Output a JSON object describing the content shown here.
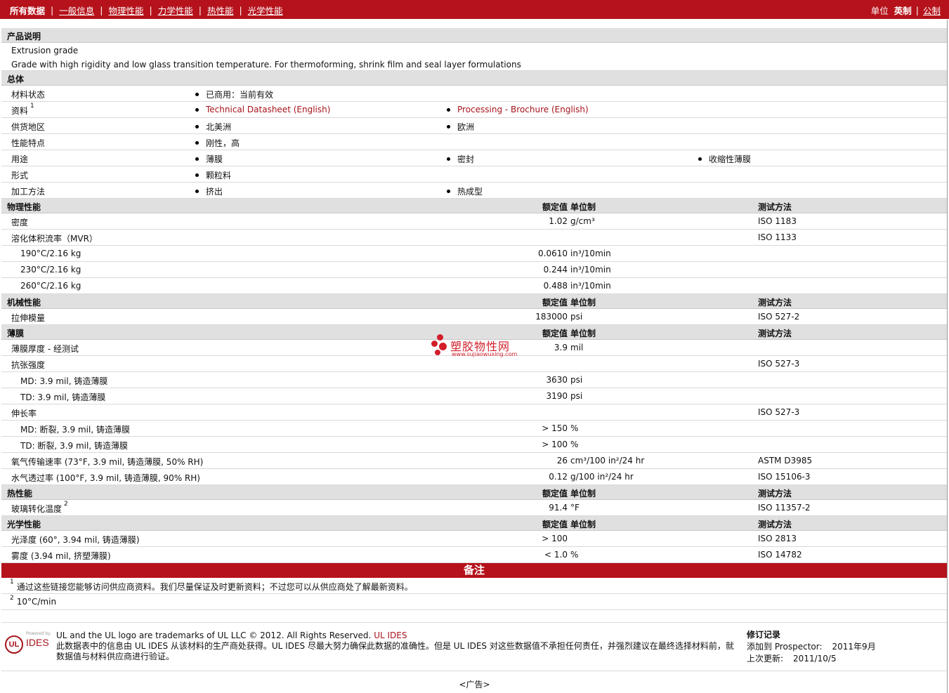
{
  "nav": {
    "all_data": "所有数据",
    "links": [
      "一般信息",
      "物理性能",
      "力学性能",
      "热性能",
      "光学性能"
    ],
    "units_label": "单位",
    "english": "英制",
    "metric": "公制"
  },
  "product": {
    "heading": "产品说明",
    "line1": "Extrusion grade",
    "line2": "Grade with high rigidity and low glass transition temperature. For thermoforming, shrink film and seal layer formulations"
  },
  "general": {
    "heading": "总体",
    "rows": [
      {
        "label": "材料状态",
        "items": [
          "已商用：当前有效"
        ]
      },
      {
        "label": "资料",
        "sup": "1",
        "items": [
          "Technical Datasheet (English)",
          "Processing - Brochure (English)"
        ],
        "links": true
      },
      {
        "label": "供货地区",
        "items": [
          "北美洲",
          "欧洲"
        ]
      },
      {
        "label": "性能特点",
        "items": [
          "刚性，高"
        ]
      },
      {
        "label": "用途",
        "items": [
          "薄膜",
          "密封",
          "收缩性薄膜"
        ]
      },
      {
        "label": "形式",
        "items": [
          "颗粒料"
        ]
      },
      {
        "label": "加工方法",
        "items": [
          "挤出",
          "热成型"
        ]
      }
    ]
  },
  "col_headers": {
    "value": "额定值",
    "unit": "单位制",
    "test": "测试方法"
  },
  "sections": [
    {
      "title": "物理性能",
      "rows": [
        {
          "label": "密度",
          "value": "1.02",
          "unit": "g/cm³",
          "test": "ISO 1183"
        },
        {
          "label": "溶化体积流率（MVR）",
          "value": "",
          "unit": "",
          "test": "ISO 1133"
        },
        {
          "label": "190°C/2.16 kg",
          "sub": true,
          "value": "0.0610",
          "unit": "in³/10min",
          "test": ""
        },
        {
          "label": "230°C/2.16 kg",
          "sub": true,
          "value": "0.244",
          "unit": "in³/10min",
          "test": ""
        },
        {
          "label": "260°C/2.16 kg",
          "sub": true,
          "value": "0.488",
          "unit": "in³/10min",
          "test": ""
        }
      ]
    },
    {
      "title": "机械性能",
      "rows": [
        {
          "label": "拉伸模量",
          "value": "183000",
          "unit": "psi",
          "test": "ISO 527-2"
        }
      ]
    },
    {
      "title": "薄膜",
      "rows": [
        {
          "label": "薄膜厚度 - 经测试",
          "value": "3.9",
          "unit": "mil",
          "test": ""
        },
        {
          "label": "抗张强度",
          "value": "",
          "unit": "",
          "test": "ISO 527-3"
        },
        {
          "label": "MD: 3.9 mil, 铸造薄膜",
          "sub": true,
          "value": "3630",
          "unit": "psi",
          "test": ""
        },
        {
          "label": "TD: 3.9 mil, 铸造薄膜",
          "sub": true,
          "value": "3190",
          "unit": "psi",
          "test": ""
        },
        {
          "label": "伸长率",
          "value": "",
          "unit": "",
          "test": "ISO 527-3"
        },
        {
          "label": "MD: 断裂, 3.9 mil, 铸造薄膜",
          "sub": true,
          "value": "> 150",
          "unit": "%",
          "test": ""
        },
        {
          "label": "TD: 断裂, 3.9 mil, 铸造薄膜",
          "sub": true,
          "value": "> 100",
          "unit": "%",
          "test": ""
        },
        {
          "label": "氧气传输速率 (73°F, 3.9 mil, 铸造薄膜, 50% RH)",
          "value": "26",
          "unit": "cm³/100 in²/24 hr",
          "test": "ASTM D3985"
        },
        {
          "label": "水气透过率 (100°F, 3.9 mil, 铸造薄膜, 90% RH)",
          "value": "0.12",
          "unit": "g/100 in²/24 hr",
          "test": "ISO 15106-3"
        }
      ]
    },
    {
      "title": "热性能",
      "rows": [
        {
          "label": "玻璃转化温度",
          "sup": "2",
          "value": "91.4",
          "unit": "°F",
          "test": "ISO 11357-2"
        }
      ]
    },
    {
      "title": "光学性能",
      "rows": [
        {
          "label": "光泽度 (60°, 3.94 mil, 铸造薄膜)",
          "value": "> 100",
          "unit": "",
          "test": "ISO 2813"
        },
        {
          "label": "雾度 (3.94 mil, 挤塑薄膜)",
          "value": "< 1.0",
          "unit": "%",
          "test": "ISO 14782"
        }
      ]
    }
  ],
  "watermark": {
    "title": "塑胶物性网",
    "url": "www.sujiaowuxing.com"
  },
  "notes": {
    "heading": "备注",
    "items": [
      {
        "num": "1",
        "text": "通过这些链接您能够访问供应商资料。我们尽量保证及时更新资料；不过您可以从供应商处了解最新资料。"
      },
      {
        "num": "2",
        "text": "10°C/min"
      }
    ]
  },
  "footer": {
    "logo_ul": "UL",
    "logo_powered": "Powered by",
    "logo_ides": "IDES",
    "trademark": "UL and the UL logo are trademarks of UL LLC © 2012. All Rights Reserved.",
    "trademark_link": "UL IDES",
    "disclaimer": "此数据表中的信息由 UL IDES 从该材料的生产商处获得。UL IDES 尽最大努力确保此数据的准确性。但是 UL IDES 对这些数据值不承担任何责任，并强烈建议在最终选择材料前，就数据值与材料供应商进行验证。",
    "revision_title": "修订记录",
    "added_label": "添加到 Prospector:",
    "added_value": "2011年9月",
    "updated_label": "上次更新:",
    "updated_value": "2011/10/5"
  },
  "ad": "<广告>",
  "colors": {
    "brand_red": "#b5121b",
    "header_gray": "#e0e0e0",
    "link_red": "#a5141c"
  }
}
